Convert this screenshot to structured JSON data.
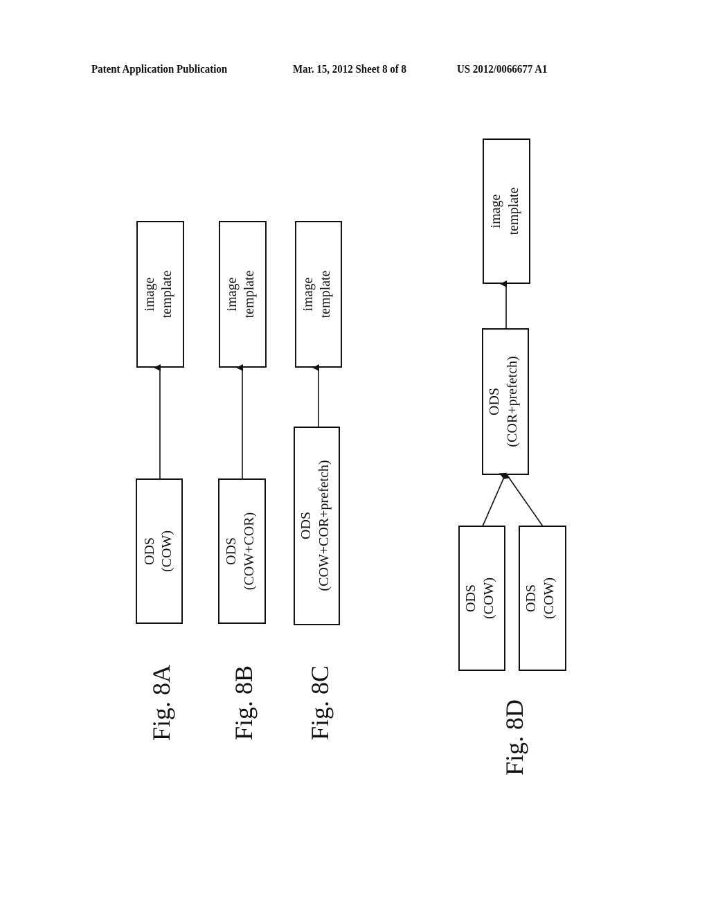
{
  "header": {
    "left": "Patent Application Publication",
    "middle": "Mar. 15, 2012  Sheet 8 of 8",
    "right": "US 2012/0066677 A1"
  },
  "figures": {
    "fig8a": {
      "label": "Fig. 8A",
      "target": {
        "line1": "image",
        "line2": "template"
      },
      "source": {
        "line1": "ODS",
        "line2": "(COW)"
      }
    },
    "fig8b": {
      "label": "Fig. 8B",
      "target": {
        "line1": "image",
        "line2": "template"
      },
      "source": {
        "line1": "ODS",
        "line2": "(COW+COR)"
      }
    },
    "fig8c": {
      "label": "Fig. 8C",
      "target": {
        "line1": "image",
        "line2": "template"
      },
      "source": {
        "line1": "ODS",
        "line2": "(COW+COR+prefetch)"
      }
    },
    "fig8d": {
      "label": "Fig. 8D",
      "target": {
        "line1": "image",
        "line2": "template"
      },
      "middle": {
        "line1": "ODS",
        "line2": "(COR+prefetch)"
      },
      "sources": [
        {
          "line1": "ODS",
          "line2": "(COW)"
        },
        {
          "line1": "ODS",
          "line2": "(COW)"
        }
      ]
    }
  }
}
